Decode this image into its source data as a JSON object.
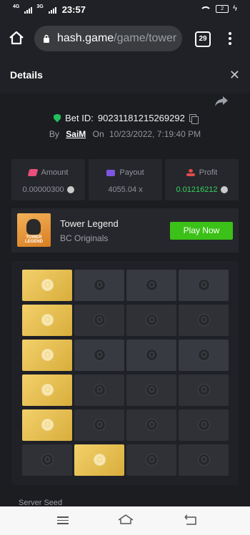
{
  "status_bar": {
    "network_1": "4G",
    "network_2": "3G",
    "time": "23:57",
    "battery": "2"
  },
  "browser": {
    "url_host": "hash.game",
    "url_path": "/game/tower",
    "tab_count": "29"
  },
  "details": {
    "title": "Details",
    "bet_id_label": "Bet ID:",
    "bet_id": "90231181215269292",
    "by_label": "By",
    "user": "SaiM",
    "on_label": "On",
    "timestamp": "10/23/2022, 7:19:40 PM"
  },
  "stats": [
    {
      "label": "Amount",
      "value": "0.00000300",
      "icon": "amount-icon"
    },
    {
      "label": "Payout",
      "value": "4055.04 x",
      "icon": "payout-icon"
    },
    {
      "label": "Profit",
      "value": "0.01216212",
      "icon": "profit-icon"
    }
  ],
  "game": {
    "name": "Tower Legend",
    "provider": "BC Originals",
    "play_label": "Play Now",
    "thumb_text": "TOWER LEGEND"
  },
  "board": {
    "rows": 6,
    "cols": 4,
    "gold_cells": [
      [
        0,
        0
      ],
      [
        1,
        0
      ],
      [
        2,
        0
      ],
      [
        3,
        0
      ],
      [
        4,
        0
      ],
      [
        5,
        1
      ]
    ],
    "colors": {
      "gold": "#e8c24f",
      "cell": "#2f3136",
      "top_cell": "#373a40"
    }
  },
  "server_seed_label": "Server Seed",
  "colors": {
    "accent_green": "#3bc117",
    "profit_green": "#32d45d",
    "background": "#1c1d21"
  }
}
